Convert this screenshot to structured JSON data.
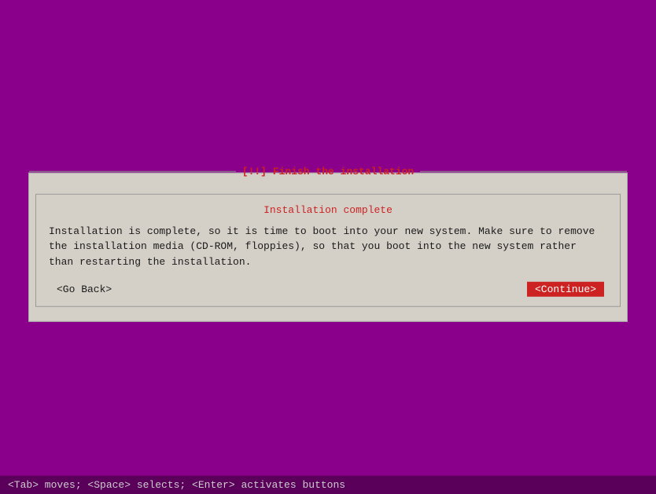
{
  "background_color": "#8b008b",
  "dialog": {
    "title": "[!!] Finish the installation",
    "subtitle": "Installation complete",
    "body_line1": "Installation is complete, so it is time to boot into your new system. Make sure to remove",
    "body_line2": "the installation media (CD-ROM, floppies), so that you boot into the new system rather",
    "body_line3": "than restarting the installation.",
    "go_back_label": "<Go Back>",
    "continue_label": "<Continue>"
  },
  "statusbar": {
    "text": "<Tab> moves; <Space> selects; <Enter> activates buttons"
  }
}
